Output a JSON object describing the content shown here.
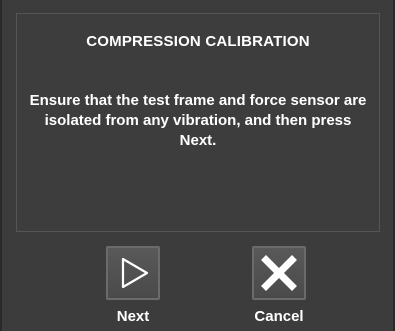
{
  "dialog": {
    "title": "COMPRESSION CALIBRATION",
    "message": "Ensure that the test frame and force sensor are isolated from any vibration, and then press Next."
  },
  "buttons": {
    "next": {
      "label": "Next",
      "icon": "play-triangle-icon"
    },
    "cancel": {
      "label": "Cancel",
      "icon": "close-x-icon"
    }
  },
  "colors": {
    "background": "#3c3c3c",
    "panel_border": "#555555",
    "text": "#ffffff",
    "button_face": "#595959"
  }
}
